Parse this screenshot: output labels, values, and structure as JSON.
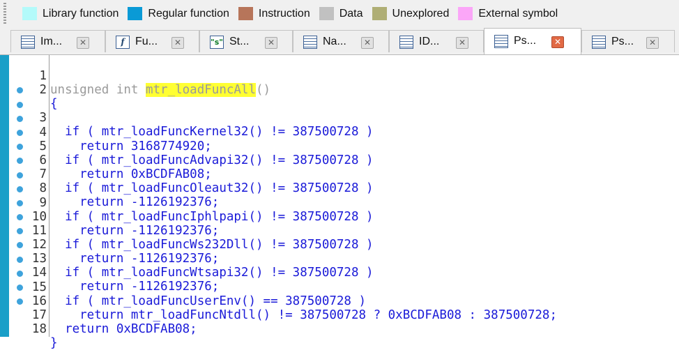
{
  "legend": {
    "items": [
      {
        "label": "Library function",
        "color": "#b3fafa"
      },
      {
        "label": "Regular function",
        "color": "#0a9ad6"
      },
      {
        "label": "Instruction",
        "color": "#b7755a"
      },
      {
        "label": "Data",
        "color": "#c1c1c1"
      },
      {
        "label": "Unexplored",
        "color": "#afae75"
      },
      {
        "label": "External symbol",
        "color": "#fba6f8"
      }
    ]
  },
  "tabs": [
    {
      "label": "Im...",
      "icon": "imports-icon",
      "active": false
    },
    {
      "label": "Fu...",
      "icon": "function-icon",
      "active": false
    },
    {
      "label": "St...",
      "icon": "strings-icon",
      "active": false
    },
    {
      "label": "Na...",
      "icon": "names-icon",
      "active": false
    },
    {
      "label": "ID...",
      "icon": "ida-view-icon",
      "active": false
    },
    {
      "label": "Ps...",
      "icon": "pseudocode-icon",
      "active": true
    },
    {
      "label": "Ps...",
      "icon": "pseudocode-icon",
      "active": false
    }
  ],
  "tab_close_glyph": "✕",
  "code": {
    "function_name": "mtr_loadFuncAll",
    "lines": [
      {
        "num": "1",
        "pre": "unsigned int ",
        "hl": "mtr_loadFuncAll",
        "post": "()",
        "bp": false
      },
      {
        "num": "2",
        "text": "{",
        "bp": false
      },
      {
        "num": "3",
        "text": "  if ( mtr_loadFuncKernel32() != 387500728 )",
        "bp": true
      },
      {
        "num": "4",
        "text": "    return 3168774920;",
        "bp": true
      },
      {
        "num": "5",
        "text": "  if ( mtr_loadFuncAdvapi32() != 387500728 )",
        "bp": true
      },
      {
        "num": "6",
        "text": "    return 0xBCDFAB08;",
        "bp": true
      },
      {
        "num": "7",
        "text": "  if ( mtr_loadFuncOleaut32() != 387500728 )",
        "bp": true
      },
      {
        "num": "8",
        "text": "    return -1126192376;",
        "bp": true
      },
      {
        "num": "9",
        "text": "  if ( mtr_loadFuncIphlpapi() != 387500728 )",
        "bp": true
      },
      {
        "num": "10",
        "text": "    return -1126192376;",
        "bp": true
      },
      {
        "num": "11",
        "text": "  if ( mtr_loadFuncWs232Dll() != 387500728 )",
        "bp": true
      },
      {
        "num": "12",
        "text": "    return -1126192376;",
        "bp": true
      },
      {
        "num": "13",
        "text": "  if ( mtr_loadFuncWtsapi32() != 387500728 )",
        "bp": true
      },
      {
        "num": "14",
        "text": "    return -1126192376;",
        "bp": true
      },
      {
        "num": "15",
        "text": "  if ( mtr_loadFuncUserEnv() == 387500728 )",
        "bp": true
      },
      {
        "num": "16",
        "text": "    return mtr_loadFuncNtdll() != 387500728 ? 0xBCDFAB08 : 387500728;",
        "bp": true
      },
      {
        "num": "17",
        "text": "  return 0xBCDFAB08;",
        "bp": true
      },
      {
        "num": "18",
        "text": "}",
        "bp": true
      }
    ]
  }
}
